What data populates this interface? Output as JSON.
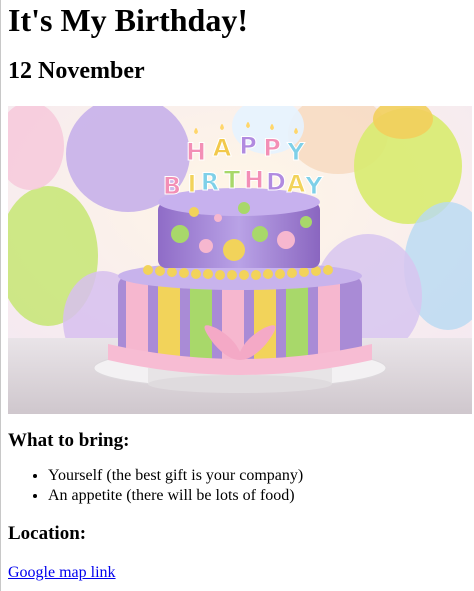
{
  "page": {
    "title": "It's My Birthday!",
    "date": "12 November",
    "image": {
      "subject": "birthday-cake-photo",
      "candle_letters": [
        "H",
        "A",
        "P",
        "P",
        "Y",
        "B",
        "I",
        "R",
        "T",
        "H",
        "D",
        "A",
        "Y"
      ],
      "colors": {
        "purple": "#a98bd6",
        "lavender": "#c8b3ec",
        "pink": "#f6b7cf",
        "yellow": "#f2d35a",
        "green": "#a8d86a",
        "blue": "#7fd0e8"
      }
    },
    "bring": {
      "heading": "What to bring:",
      "items": [
        "Yourself (the best gift is your company)",
        "An appetite (there will be lots of food)"
      ]
    },
    "location": {
      "heading": "Location:",
      "link_text": "Google map link"
    }
  }
}
